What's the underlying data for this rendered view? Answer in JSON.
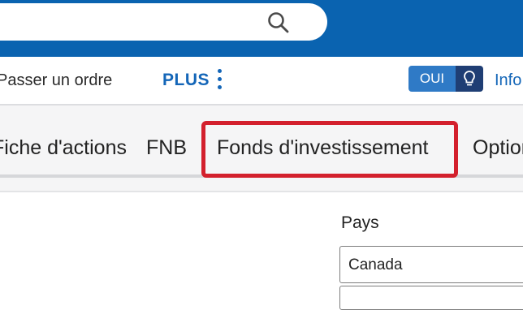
{
  "header": {
    "search": {
      "value": "",
      "icon": "search-icon"
    },
    "colors": {
      "brand": "#0a63b0",
      "highlight": "#d3202d"
    }
  },
  "subnav": {
    "place_order": "Passer un ordre",
    "plus": "PLUS",
    "toggle_label": "OUI",
    "info_link": "Info"
  },
  "tabs": [
    {
      "label": "Fiche d'actions"
    },
    {
      "label": "FNB"
    },
    {
      "label": "Fonds d'investissement",
      "highlighted": true
    },
    {
      "label": "Options"
    }
  ],
  "form": {
    "country_label": "Pays",
    "country_value": "Canada"
  }
}
